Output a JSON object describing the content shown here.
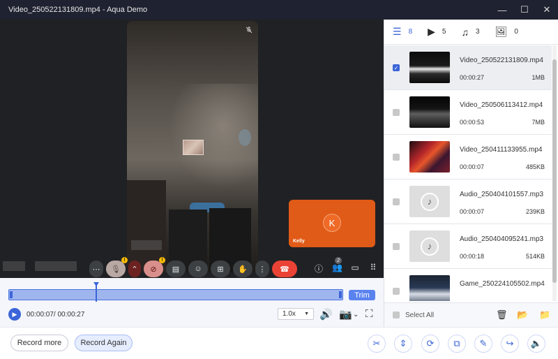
{
  "window": {
    "title": "Video_250522131809.mp4   -   Aqua Demo",
    "min": "—",
    "max": "☐",
    "close": "✕"
  },
  "player": {
    "pip_initial": "K",
    "pip_name": "Kelly",
    "participants_count": "2",
    "warn_mark": "!"
  },
  "timeline": {
    "trim_label": "Trim",
    "timecode": "00:00:07/ 00:00:27",
    "speed": "1.0x",
    "progress": 0.26
  },
  "bottom": {
    "record_more": "Record more",
    "record_again": "Record Again"
  },
  "sidebar": {
    "categories": [
      {
        "icon": "list-icon",
        "count": "8"
      },
      {
        "icon": "video-icon",
        "count": "5"
      },
      {
        "icon": "music-icon",
        "count": "3"
      },
      {
        "icon": "image-icon",
        "count": "0"
      }
    ],
    "items": [
      {
        "name": "Video_250522131809.mp4",
        "duration": "00:00:27",
        "size": "1MB",
        "type": "video",
        "selected": true
      },
      {
        "name": "Video_250506113412.mp4",
        "duration": "00:00:53",
        "size": "7MB",
        "type": "video",
        "selected": false
      },
      {
        "name": "Video_250411133955.mp4",
        "duration": "00:00:07",
        "size": "485KB",
        "type": "video",
        "selected": false
      },
      {
        "name": "Audio_250404101557.mp3",
        "duration": "00:00:07",
        "size": "239KB",
        "type": "audio",
        "selected": false
      },
      {
        "name": "Audio_250404095241.mp3",
        "duration": "00:00:18",
        "size": "514KB",
        "type": "audio",
        "selected": false
      },
      {
        "name": "Game_250224105502.mp4",
        "duration": "",
        "size": "",
        "type": "game",
        "selected": false
      }
    ],
    "select_all": "Select All"
  },
  "colors": {
    "accent": "#3b65d8",
    "end_call": "#ea4335",
    "pip_bg": "#e05b17"
  }
}
